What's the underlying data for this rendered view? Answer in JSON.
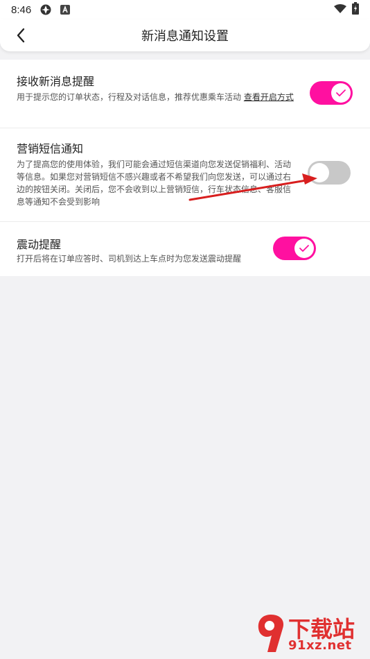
{
  "status_bar": {
    "time": "8:46",
    "icons": [
      "app-icon",
      "a-badge-icon",
      "wifi-icon",
      "battery-charging-icon"
    ]
  },
  "header": {
    "title": "新消息通知设置",
    "back_icon": "chevron-left-icon"
  },
  "settings": [
    {
      "title": "接收新消息提醒",
      "description": "用于提示您的订单状态，行程及对话信息，推荐优惠乘车活动",
      "link": "查看开启方式",
      "enabled": true
    },
    {
      "title": "营销短信通知",
      "description": "为了提高您的使用体验，我们可能会通过短信渠道向您发送促销福利、活动等信息。如果您对营销短信不感兴趣或者不希望我们向您发送，可以通过右边的按钮关闭。关闭后，您不会收到以上营销短信，行车状态信息、客服信息等通知不会受到影响",
      "enabled": false
    },
    {
      "title": "震动提醒",
      "description": "打开后将在订单应答时、司机到达上车点时为您发送震动提醒",
      "enabled": true
    }
  ],
  "watermark": {
    "top": "下载站",
    "bottom": "91xz.net"
  },
  "colors": {
    "accent": "#ff10a0",
    "toggle_off": "#c8c8c8",
    "annotation_arrow": "#d81e1e",
    "watermark": "#e03030"
  }
}
